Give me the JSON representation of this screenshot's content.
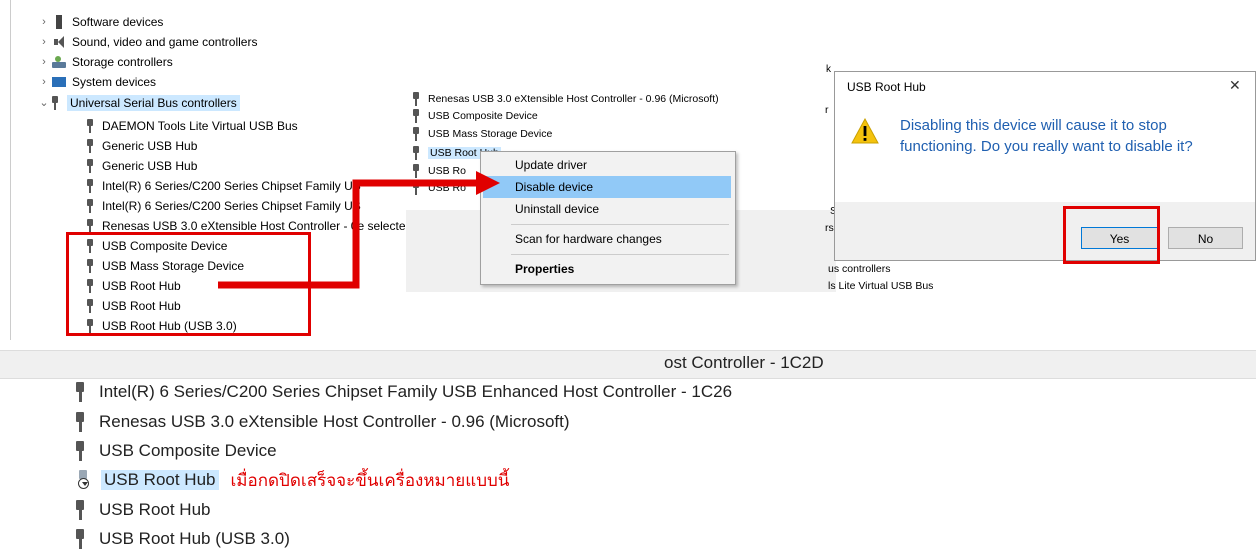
{
  "tree_left": {
    "collapsed": [
      {
        "label": "Software devices",
        "icon": "software-devices-icon"
      },
      {
        "label": "Sound, video and game controllers",
        "icon": "speaker-icon"
      },
      {
        "label": "Storage controllers",
        "icon": "storage-controller-icon"
      },
      {
        "label": "System devices",
        "icon": "system-devices-icon"
      }
    ],
    "expanded_category": "Universal Serial Bus controllers",
    "children": [
      "DAEMON Tools Lite Virtual USB Bus",
      "Generic USB Hub",
      "Generic USB Hub",
      "Intel(R) 6 Series/C200 Series Chipset Family US",
      "Intel(R) 6 Series/C200 Series Chipset Family US",
      "Renesas USB 3.0 eXtensible Host Controller - 0e selected d",
      "USB Composite Device",
      "USB Mass Storage Device",
      "USB Root Hub",
      "USB Root Hub",
      "USB Root Hub (USB 3.0)"
    ]
  },
  "tree_mid": {
    "items": [
      "Renesas USB 3.0 eXtensible Host Controller - 0.96 (Microsoft)",
      "USB Composite Device",
      "USB Mass Storage Device",
      "USB Root Hub",
      "USB Ro",
      "USB Ro"
    ]
  },
  "context_menu": {
    "items": [
      "Update driver",
      "Disable device",
      "Uninstall device",
      "Scan for hardware changes",
      "Properties"
    ]
  },
  "dialog": {
    "title": "USB Root Hub",
    "close": "✕",
    "message": "Disabling this device will cause it to stop functioning. Do you really want to disable it?",
    "yes": "Yes",
    "no": "No",
    "bg_left_1": "r",
    "bg_left_2": "rs",
    "bg_left_3": "S",
    "bg_left_4": "k"
  },
  "behind": {
    "line1": "us controllers",
    "line2": "ls Lite Virtual USB Bus"
  },
  "bottom": {
    "partial": "ost Controller - 1C2D",
    "items": [
      "Intel(R) 6 Series/C200 Series Chipset Family USB Enhanced Host Controller - 1C26",
      "Renesas USB 3.0 eXtensible Host Controller - 0.96 (Microsoft)",
      "USB Composite Device",
      "USB Root Hub",
      "USB Root Hub",
      "USB Root Hub (USB 3.0)"
    ],
    "annotation": "เมื่อกดปิดเสร็จจะขึ้นเครื่องหมายแบบนี้"
  },
  "colors": {
    "highlight": "#e00000",
    "selection": "#cce8ff",
    "link_blue": "#1f5fb0"
  }
}
